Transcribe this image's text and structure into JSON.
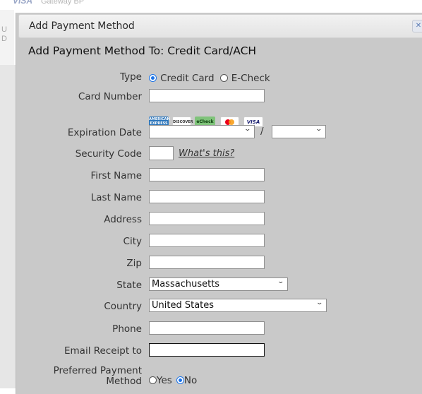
{
  "background": {
    "logo": "VISA",
    "gateway": "Gateway  BP",
    "side_text": "U\nD"
  },
  "modal": {
    "title": "Add Payment Method",
    "close_icon": "close-icon",
    "heading": "Add Payment Method To: Credit Card/ACH"
  },
  "form": {
    "type": {
      "label": "Type",
      "options": [
        "Credit Card",
        "E-Check"
      ],
      "selected": "Credit Card"
    },
    "card_number": {
      "label": "Card Number",
      "value": ""
    },
    "card_logos": [
      {
        "name": "amex",
        "text": "AMERICAN EXPRESS"
      },
      {
        "name": "discover",
        "text": "DISCOVER"
      },
      {
        "name": "echeck",
        "text": "eCheck"
      },
      {
        "name": "mastercard",
        "text": "mastercard"
      },
      {
        "name": "visa",
        "text": "VISA"
      }
    ],
    "expiration": {
      "label": "Expiration Date",
      "month": "",
      "separator": "/",
      "year": ""
    },
    "security": {
      "label": "Security Code",
      "value": "",
      "help_link": "What's this?"
    },
    "first_name": {
      "label": "First Name",
      "value": ""
    },
    "last_name": {
      "label": "Last Name",
      "value": ""
    },
    "address": {
      "label": "Address",
      "value": ""
    },
    "city": {
      "label": "City",
      "value": ""
    },
    "zip": {
      "label": "Zip",
      "value": ""
    },
    "state": {
      "label": "State",
      "value": "Massachusetts"
    },
    "country": {
      "label": "Country",
      "value": "United States"
    },
    "phone": {
      "label": "Phone",
      "value": ""
    },
    "email": {
      "label": "Email Receipt to",
      "value": ""
    },
    "preferred": {
      "label_line1": "Preferred Payment",
      "label_line2": "Method",
      "options": [
        "Yes",
        "No"
      ],
      "selected": "No"
    }
  },
  "colors": {
    "accent": "#1a73e8",
    "modal_bg": "#c9c9c9"
  }
}
